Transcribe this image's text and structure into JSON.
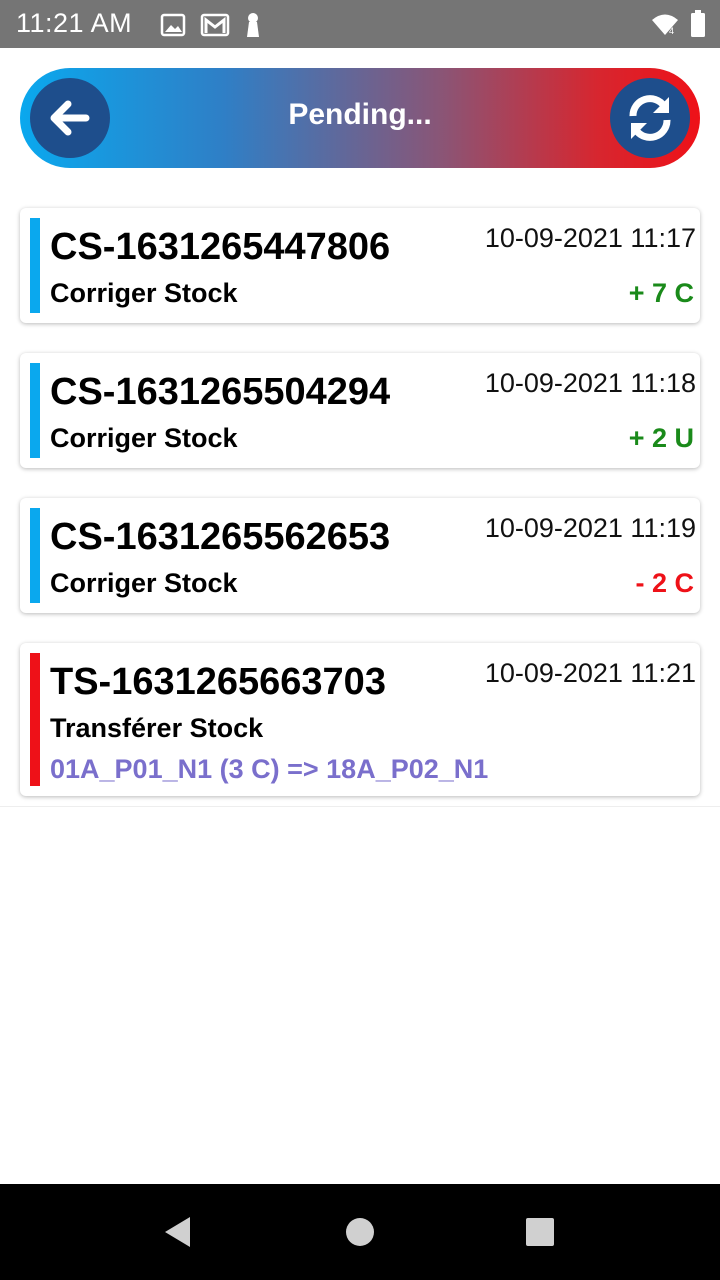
{
  "status_bar": {
    "time": "11:21 AM",
    "left_icons": [
      "image-icon",
      "gmail-icon",
      "keyhole-icon"
    ],
    "right_icons": [
      "wifi-icon",
      "battery-icon"
    ]
  },
  "header": {
    "title": "Pending...",
    "back_icon": "arrow-left-icon",
    "refresh_icon": "refresh-icon"
  },
  "colors": {
    "bar_blue": "#0aa8ee",
    "bar_red": "#ee1118",
    "qty_positive": "#1a8a1a",
    "qty_negative": "#ee1118",
    "route": "#7a6fcc",
    "header_button": "#1e4e8c"
  },
  "items": [
    {
      "id": "CS-1631265447806",
      "datetime": "10-09-2021 11:17",
      "type": "Corriger Stock",
      "qty": "+ 7 C",
      "qty_sign": "positive",
      "bar": "blue"
    },
    {
      "id": "CS-1631265504294",
      "datetime": "10-09-2021 11:18",
      "type": "Corriger Stock",
      "qty": "+ 2 U",
      "qty_sign": "positive",
      "bar": "blue"
    },
    {
      "id": "CS-1631265562653",
      "datetime": "10-09-2021 11:19",
      "type": "Corriger Stock",
      "qty": "- 2 C",
      "qty_sign": "negative",
      "bar": "blue"
    },
    {
      "id": "TS-1631265663703",
      "datetime": "10-09-2021 11:21",
      "type": "Transférer Stock",
      "route": "01A_P01_N1 (3 C) => 18A_P02_N1",
      "bar": "red"
    }
  ],
  "nav": {
    "back_icon": "nav-back-icon",
    "home_icon": "nav-home-icon",
    "recents_icon": "nav-recents-icon"
  }
}
